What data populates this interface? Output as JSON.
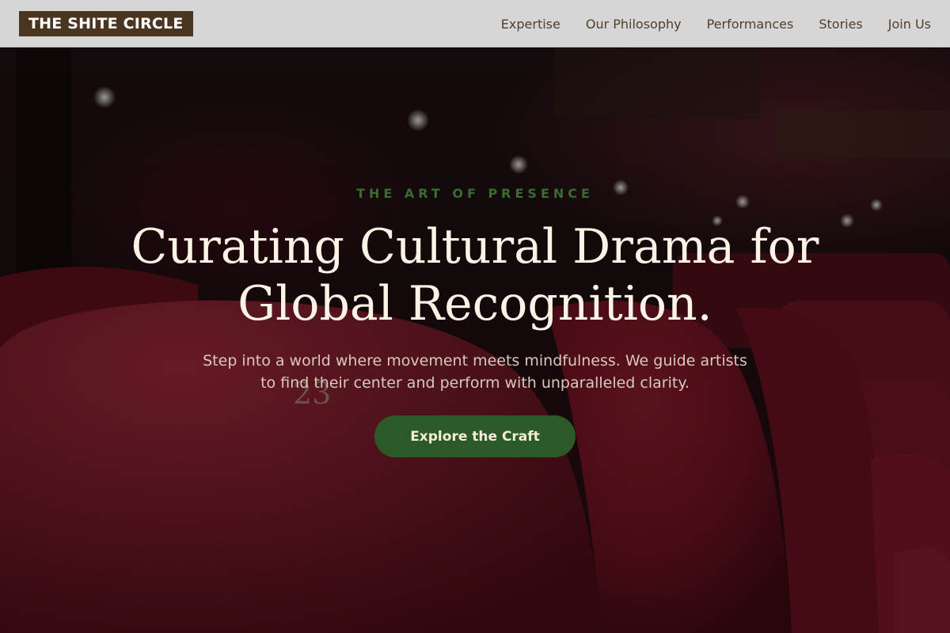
{
  "header": {
    "logo": "THE SHITE CIRCLE",
    "nav": [
      {
        "label": "Expertise"
      },
      {
        "label": "Our Philosophy"
      },
      {
        "label": "Performances"
      },
      {
        "label": "Stories"
      },
      {
        "label": "Join Us"
      }
    ]
  },
  "hero": {
    "eyebrow": "THE ART OF PRESENCE",
    "headline_line1": "Curating Cultural Drama for",
    "headline_line2": "Global Recognition.",
    "subtitle": "Step into a world where movement meets mindfulness. We guide artists to find their center and perform with unparalleled clarity.",
    "cta_label": "Explore the Craft"
  },
  "colors": {
    "header_bg": "#d6d6d6",
    "logo_bg": "#4a3521",
    "nav_text": "#4f3e2c",
    "accent_green": "#2b5a28",
    "eyebrow_green": "#3a6b33",
    "headline_text": "#fbf3e6",
    "seat_red": "#7a1222"
  }
}
